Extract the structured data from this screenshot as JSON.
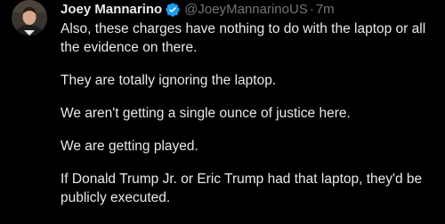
{
  "tweet": {
    "author": {
      "display_name": "Joey Mannarino",
      "handle": "@JoeyMannarinoUS",
      "verified": true,
      "verified_color": "#1d9bf0"
    },
    "separator": "·",
    "timestamp": "7m",
    "paragraphs": [
      "Also, these charges have nothing to do with the laptop or all the evidence on there.",
      "They are totally ignoring the laptop.",
      "We aren't getting a single ounce of justice here.",
      "We are getting played.",
      "If Donald Trump Jr. or Eric Trump had that laptop, they'd be publicly executed."
    ]
  },
  "theme": {
    "background": "#000000",
    "text_color": "#e7e9ea",
    "muted_color": "#71767b"
  }
}
